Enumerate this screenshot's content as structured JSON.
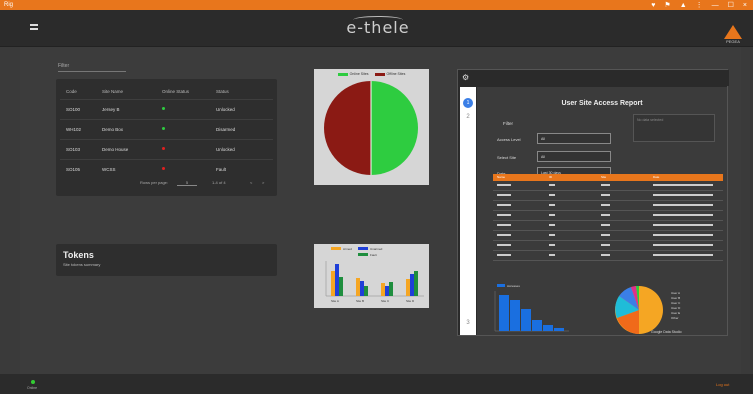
{
  "titlebar": {
    "title": "Rig",
    "controls": [
      "—",
      "☐",
      "×"
    ],
    "tray_icons": [
      "♥",
      "⚑",
      "▲",
      "⋮"
    ]
  },
  "appbar": {
    "logo": "e-thele",
    "brand": "PEGEA"
  },
  "filter": {
    "label": "Filter"
  },
  "table": {
    "headers": [
      "Code",
      "Site Name",
      "Online Status",
      "Status"
    ],
    "rows": [
      {
        "code": "SO100",
        "name": "Jersey B",
        "status": "Unlocked",
        "online": true
      },
      {
        "code": "WH102",
        "name": "Demo Box",
        "status": "Disarmed",
        "online": true
      },
      {
        "code": "SO103",
        "name": "Demo House",
        "status": "Unlocked",
        "online": false
      },
      {
        "code": "SO105",
        "name": "WCSS",
        "status": "Fault",
        "online": false
      }
    ],
    "pager": {
      "rows_label": "Rows per page:",
      "rows_value": "5",
      "range": "1-4 of 4",
      "prev": "<",
      "next": ">"
    }
  },
  "tokens": {
    "title": "Tokens",
    "subtitle": "Site tokens summary"
  },
  "pie": {
    "legend": [
      {
        "label": "Online Sites",
        "color": "#2ecc40"
      },
      {
        "label": "Offline Sites",
        "color": "#8b1a14"
      }
    ]
  },
  "bars": {
    "legend": [
      {
        "label": "Armed",
        "color": "#f5a623"
      },
      {
        "label": "Unarmed",
        "color": "#1f3fd8"
      },
      {
        "label": "Fault",
        "color": "#1e8e3e"
      }
    ],
    "categories": [
      "Site A",
      "Site B",
      "Site C",
      "Site D"
    ]
  },
  "report": {
    "title": "User Site Access Report",
    "filter_label": "Filter",
    "fields": [
      {
        "label": "Access Level",
        "value": "All"
      },
      {
        "label": "Select Site",
        "value": "All"
      },
      {
        "label": "Date",
        "value": "Last 30 days"
      }
    ],
    "info": "No data selected",
    "table_headers": [
      "Name",
      "ID",
      "Site",
      "Date"
    ],
    "bar_legend": "Accesses",
    "pie_legend": [
      "User A",
      "User B",
      "User C",
      "User D",
      "User E",
      "Other"
    ],
    "footer": "Google Data Studio",
    "side_nav": [
      "1",
      "2",
      "3"
    ]
  },
  "status": {
    "left": "Online",
    "right": "Log out"
  },
  "colors": {
    "accent": "#e8761c",
    "bg": "#3a3a3a",
    "card": "#2e2e2e"
  }
}
